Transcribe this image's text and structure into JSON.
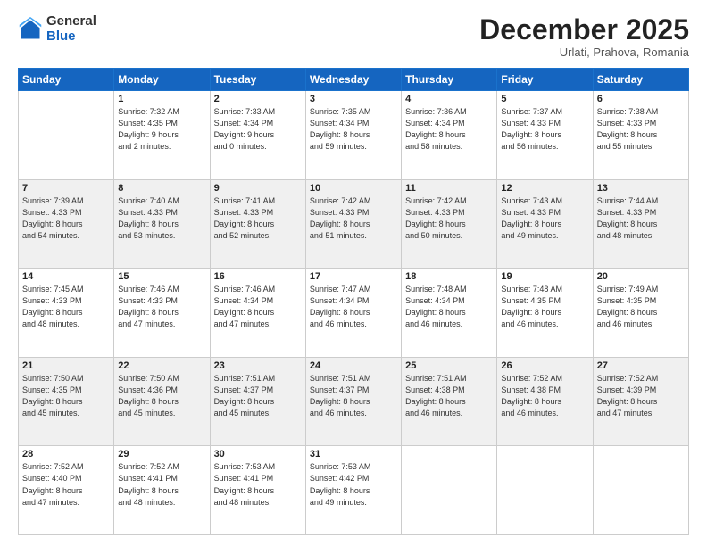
{
  "logo": {
    "general": "General",
    "blue": "Blue"
  },
  "header": {
    "month": "December 2025",
    "location": "Urlati, Prahova, Romania"
  },
  "days_of_week": [
    "Sunday",
    "Monday",
    "Tuesday",
    "Wednesday",
    "Thursday",
    "Friday",
    "Saturday"
  ],
  "weeks": [
    [
      {
        "day": "",
        "info": ""
      },
      {
        "day": "1",
        "info": "Sunrise: 7:32 AM\nSunset: 4:35 PM\nDaylight: 9 hours\nand 2 minutes."
      },
      {
        "day": "2",
        "info": "Sunrise: 7:33 AM\nSunset: 4:34 PM\nDaylight: 9 hours\nand 0 minutes."
      },
      {
        "day": "3",
        "info": "Sunrise: 7:35 AM\nSunset: 4:34 PM\nDaylight: 8 hours\nand 59 minutes."
      },
      {
        "day": "4",
        "info": "Sunrise: 7:36 AM\nSunset: 4:34 PM\nDaylight: 8 hours\nand 58 minutes."
      },
      {
        "day": "5",
        "info": "Sunrise: 7:37 AM\nSunset: 4:33 PM\nDaylight: 8 hours\nand 56 minutes."
      },
      {
        "day": "6",
        "info": "Sunrise: 7:38 AM\nSunset: 4:33 PM\nDaylight: 8 hours\nand 55 minutes."
      }
    ],
    [
      {
        "day": "7",
        "info": "Sunrise: 7:39 AM\nSunset: 4:33 PM\nDaylight: 8 hours\nand 54 minutes."
      },
      {
        "day": "8",
        "info": "Sunrise: 7:40 AM\nSunset: 4:33 PM\nDaylight: 8 hours\nand 53 minutes."
      },
      {
        "day": "9",
        "info": "Sunrise: 7:41 AM\nSunset: 4:33 PM\nDaylight: 8 hours\nand 52 minutes."
      },
      {
        "day": "10",
        "info": "Sunrise: 7:42 AM\nSunset: 4:33 PM\nDaylight: 8 hours\nand 51 minutes."
      },
      {
        "day": "11",
        "info": "Sunrise: 7:42 AM\nSunset: 4:33 PM\nDaylight: 8 hours\nand 50 minutes."
      },
      {
        "day": "12",
        "info": "Sunrise: 7:43 AM\nSunset: 4:33 PM\nDaylight: 8 hours\nand 49 minutes."
      },
      {
        "day": "13",
        "info": "Sunrise: 7:44 AM\nSunset: 4:33 PM\nDaylight: 8 hours\nand 48 minutes."
      }
    ],
    [
      {
        "day": "14",
        "info": "Sunrise: 7:45 AM\nSunset: 4:33 PM\nDaylight: 8 hours\nand 48 minutes."
      },
      {
        "day": "15",
        "info": "Sunrise: 7:46 AM\nSunset: 4:33 PM\nDaylight: 8 hours\nand 47 minutes."
      },
      {
        "day": "16",
        "info": "Sunrise: 7:46 AM\nSunset: 4:34 PM\nDaylight: 8 hours\nand 47 minutes."
      },
      {
        "day": "17",
        "info": "Sunrise: 7:47 AM\nSunset: 4:34 PM\nDaylight: 8 hours\nand 46 minutes."
      },
      {
        "day": "18",
        "info": "Sunrise: 7:48 AM\nSunset: 4:34 PM\nDaylight: 8 hours\nand 46 minutes."
      },
      {
        "day": "19",
        "info": "Sunrise: 7:48 AM\nSunset: 4:35 PM\nDaylight: 8 hours\nand 46 minutes."
      },
      {
        "day": "20",
        "info": "Sunrise: 7:49 AM\nSunset: 4:35 PM\nDaylight: 8 hours\nand 46 minutes."
      }
    ],
    [
      {
        "day": "21",
        "info": "Sunrise: 7:50 AM\nSunset: 4:35 PM\nDaylight: 8 hours\nand 45 minutes."
      },
      {
        "day": "22",
        "info": "Sunrise: 7:50 AM\nSunset: 4:36 PM\nDaylight: 8 hours\nand 45 minutes."
      },
      {
        "day": "23",
        "info": "Sunrise: 7:51 AM\nSunset: 4:37 PM\nDaylight: 8 hours\nand 45 minutes."
      },
      {
        "day": "24",
        "info": "Sunrise: 7:51 AM\nSunset: 4:37 PM\nDaylight: 8 hours\nand 46 minutes."
      },
      {
        "day": "25",
        "info": "Sunrise: 7:51 AM\nSunset: 4:38 PM\nDaylight: 8 hours\nand 46 minutes."
      },
      {
        "day": "26",
        "info": "Sunrise: 7:52 AM\nSunset: 4:38 PM\nDaylight: 8 hours\nand 46 minutes."
      },
      {
        "day": "27",
        "info": "Sunrise: 7:52 AM\nSunset: 4:39 PM\nDaylight: 8 hours\nand 47 minutes."
      }
    ],
    [
      {
        "day": "28",
        "info": "Sunrise: 7:52 AM\nSunset: 4:40 PM\nDaylight: 8 hours\nand 47 minutes."
      },
      {
        "day": "29",
        "info": "Sunrise: 7:52 AM\nSunset: 4:41 PM\nDaylight: 8 hours\nand 48 minutes."
      },
      {
        "day": "30",
        "info": "Sunrise: 7:53 AM\nSunset: 4:41 PM\nDaylight: 8 hours\nand 48 minutes."
      },
      {
        "day": "31",
        "info": "Sunrise: 7:53 AM\nSunset: 4:42 PM\nDaylight: 8 hours\nand 49 minutes."
      },
      {
        "day": "",
        "info": ""
      },
      {
        "day": "",
        "info": ""
      },
      {
        "day": "",
        "info": ""
      }
    ]
  ]
}
